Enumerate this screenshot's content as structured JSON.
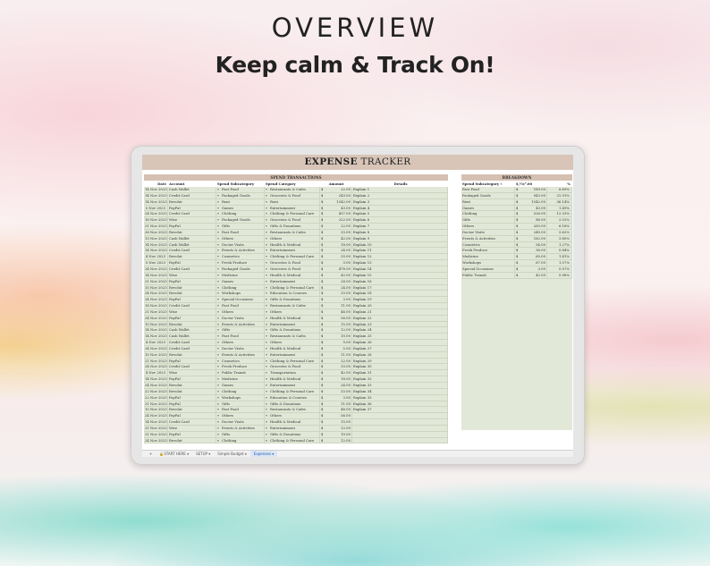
{
  "header": {
    "title": "OVERVIEW",
    "tagline": "Keep calm & Track On!"
  },
  "sheet": {
    "title_bold": "EXPENSE",
    "title_light": " TRACKER",
    "left_heading": "SPEND TRANSACTIONS",
    "right_heading": "BREAKDOWN",
    "columns": {
      "date": "Date",
      "account": "Account",
      "subcategory": "Spend Subcategory",
      "category": "Spend Category",
      "amount": "Amount",
      "details": "Details"
    },
    "breakdown_columns": {
      "subcategory": "Spend Subcategory",
      "amount": "$,½‡⁰.00",
      "percent": "%"
    },
    "currency": "$",
    "transactions": [
      {
        "date": "14 Nov 2023",
        "account": "Cash Wallet",
        "sub": "Fast Food",
        "cat": "Restaurants & Cafes",
        "amt": "22.00",
        "det": "Explain 1"
      },
      {
        "date": "14 Nov 2023",
        "account": "Credit Card",
        "sub": "Packaged Goods",
        "cat": "Groceries & Food",
        "amt": "243.00",
        "det": "Explain 2"
      },
      {
        "date": "14 Nov 2023",
        "account": "Revolut",
        "sub": "Rent",
        "cat": "Rent",
        "amt": "1542.00",
        "det": "Explain 3"
      },
      {
        "date": "5 Nov 2023",
        "account": "PayPal",
        "sub": "Games",
        "cat": "Entertainment",
        "amt": "43.00",
        "det": "Explain 4"
      },
      {
        "date": "24 Nov 2023",
        "account": "Credit Card",
        "sub": "Clothing",
        "cat": "Clothing & Personal Care",
        "amt": "437.00",
        "det": "Explain 5"
      },
      {
        "date": "16 Nov 2023",
        "account": "Wise",
        "sub": "Packaged Goods",
        "cat": "Groceries & Food",
        "amt": "222.00",
        "det": "Explain 6"
      },
      {
        "date": "21 Nov 2023",
        "account": "PayPal",
        "sub": "Gifts",
        "cat": "Gifts & Donations",
        "amt": "22.00",
        "det": "Explain 7"
      },
      {
        "date": "26 Nov 2023",
        "account": "Revolut",
        "sub": "Fast Food",
        "cat": "Restaurants & Cafes",
        "amt": "33.00",
        "det": "Explain 8"
      },
      {
        "date": "13 Nov 2023",
        "account": "Cash Wallet",
        "sub": "Others",
        "cat": "Others",
        "amt": "42.00",
        "det": "Explain 9"
      },
      {
        "date": "14 Nov 2023",
        "account": "Cash Wallet",
        "sub": "Doctor Visits",
        "cat": "Health & Medical",
        "amt": "18.00",
        "det": "Explain 10"
      },
      {
        "date": "14 Nov 2023",
        "account": "Credit Card",
        "sub": "Events & Activities",
        "cat": "Entertainment",
        "amt": "24.00",
        "det": "Explain 11"
      },
      {
        "date": "4 Nov 2023",
        "account": "Revolut",
        "sub": "Cosmetics",
        "cat": "Clothing & Personal Care",
        "amt": "33.00",
        "det": "Explain 12"
      },
      {
        "date": "5 Nov 2023",
        "account": "PayPal",
        "sub": "Fresh Produce",
        "cat": "Groceries & Food",
        "amt": "3.00",
        "det": "Explain 13"
      },
      {
        "date": "24 Nov 2023",
        "account": "Credit Card",
        "sub": "Packaged Goods",
        "cat": "Groceries & Food",
        "amt": "478.00",
        "det": "Explain 14"
      },
      {
        "date": "14 Nov 2023",
        "account": "Wise",
        "sub": "Medicine",
        "cat": "Health & Medical",
        "amt": "42.00",
        "det": "Explain 15"
      },
      {
        "date": "21 Nov 2023",
        "account": "PayPal",
        "sub": "Games",
        "cat": "Entertainment",
        "amt": "28.00",
        "det": "Explain 16"
      },
      {
        "date": "15 Nov 2023",
        "account": "Revolut",
        "sub": "Clothing",
        "cat": "Clothing & Personal Care",
        "amt": "24.00",
        "det": "Explain 17"
      },
      {
        "date": "24 Nov 2023",
        "account": "Revolut",
        "sub": "Workshops",
        "cat": "Education & Courses",
        "amt": "33.00",
        "det": "Explain 18"
      },
      {
        "date": "24 Nov 2023",
        "account": "PayPal",
        "sub": "Special Occasions",
        "cat": "Gifts & Donations",
        "amt": "3.00",
        "det": "Explain 19"
      },
      {
        "date": "16 Nov 2023",
        "account": "Credit Card",
        "sub": "Fast Food",
        "cat": "Restaurants & Cafes",
        "amt": "11.00",
        "det": "Explain 20"
      },
      {
        "date": "21 Nov 2023",
        "account": "Wise",
        "sub": "Others",
        "cat": "Others",
        "amt": "46.00",
        "det": "Explain 21"
      },
      {
        "date": "24 Nov 2023",
        "account": "PayPal",
        "sub": "Doctor Visits",
        "cat": "Health & Medical",
        "amt": "56.00",
        "det": "Explain 22"
      },
      {
        "date": "15 Nov 2023",
        "account": "Revolut",
        "sub": "Events & Activities",
        "cat": "Entertainment",
        "amt": "15.00",
        "det": "Explain 23"
      },
      {
        "date": "14 Nov 2023",
        "account": "Cash Wallet",
        "sub": "Gifts",
        "cat": "Gifts & Donations",
        "amt": "12.00",
        "det": "Explain 24"
      },
      {
        "date": "14 Nov 2023",
        "account": "Cash Wallet",
        "sub": "Fast Food",
        "cat": "Restaurants & Cafes",
        "amt": "10.00",
        "det": "Explain 25"
      },
      {
        "date": "4 Nov 2023",
        "account": "Credit Card",
        "sub": "Others",
        "cat": "Others",
        "amt": "9.00",
        "det": "Explain 26"
      },
      {
        "date": "24 Nov 2023",
        "account": "Credit Card",
        "sub": "Doctor Visits",
        "cat": "Health & Medical",
        "amt": "5.00",
        "det": "Explain 27"
      },
      {
        "date": "15 Nov 2023",
        "account": "Revolut",
        "sub": "Events & Activities",
        "cat": "Entertainment",
        "amt": "11.00",
        "det": "Explain 28"
      },
      {
        "date": "21 Nov 2023",
        "account": "PayPal",
        "sub": "Cosmetics",
        "cat": "Clothing & Personal Care",
        "amt": "22.00",
        "det": "Explain 29"
      },
      {
        "date": "24 Nov 2023",
        "account": "Credit Card",
        "sub": "Fresh Produce",
        "cat": "Groceries & Food",
        "amt": "33.00",
        "det": "Explain 30"
      },
      {
        "date": "4 Nov 2023",
        "account": "Wise",
        "sub": "Public Transit",
        "cat": "Transportation",
        "amt": "42.00",
        "det": "Explain 31"
      },
      {
        "date": "14 Nov 2023",
        "account": "PayPal",
        "sub": "Medicine",
        "cat": "Health & Medical",
        "amt": "18.00",
        "det": "Explain 32"
      },
      {
        "date": "24 Nov 2023",
        "account": "Revolut",
        "sub": "Games",
        "cat": "Entertainment",
        "amt": "24.00",
        "det": "Explain 33"
      },
      {
        "date": "22 Nov 2023",
        "account": "Revolut",
        "sub": "Clothing",
        "cat": "Clothing & Personal Care",
        "amt": "33.00",
        "det": "Explain 34"
      },
      {
        "date": "22 Nov 2023",
        "account": "PayPal",
        "sub": "Workshops",
        "cat": "Education & Courses",
        "amt": "3.00",
        "det": "Explain 35"
      },
      {
        "date": "21 Nov 2023",
        "account": "PayPal",
        "sub": "Gifts",
        "cat": "Gifts & Donations",
        "amt": "11.00",
        "det": "Explain 36"
      },
      {
        "date": "15 Nov 2023",
        "account": "Revolut",
        "sub": "Fast Food",
        "cat": "Restaurants & Cafes",
        "amt": "46.00",
        "det": "Explain 37"
      },
      {
        "date": "24 Nov 2023",
        "account": "PayPal",
        "sub": "Others",
        "cat": "Others",
        "amt": "56.00",
        "det": ""
      },
      {
        "date": "14 Nov 2023",
        "account": "Credit Card",
        "sub": "Doctor Visits",
        "cat": "Health & Medical",
        "amt": "15.00",
        "det": ""
      },
      {
        "date": "21 Nov 2023",
        "account": "Wise",
        "sub": "Events & Activities",
        "cat": "Entertainment",
        "amt": "12.00",
        "det": ""
      },
      {
        "date": "21 Nov 2023",
        "account": "PayPal",
        "sub": "Gifts",
        "cat": "Gifts & Donations",
        "amt": "10.00",
        "det": ""
      },
      {
        "date": "24 Nov 2023",
        "account": "Revolut",
        "sub": "Clothing",
        "cat": "Clothing & Personal Care",
        "amt": "12.00",
        "det": ""
      }
    ],
    "breakdown": [
      {
        "sub": "Fast Food",
        "amt": "189.00",
        "pct": "6.69%"
      },
      {
        "sub": "Packaged Goods",
        "amt": "943.00",
        "pct": "21.91%"
      },
      {
        "sub": "Rent",
        "amt": "1542.00",
        "pct": "36.14%"
      },
      {
        "sub": "Games",
        "amt": "43.00",
        "pct": "1.49%"
      },
      {
        "sub": "Clothing",
        "amt": "526.00",
        "pct": "12.33%"
      },
      {
        "sub": "Gifts",
        "amt": "86.00",
        "pct": "2.02%"
      },
      {
        "sub": "Others",
        "amt": "263.00",
        "pct": "6.16%"
      },
      {
        "sub": "Doctor Visits",
        "amt": "240.00",
        "pct": "5.62%"
      },
      {
        "sub": "Events & Activities",
        "amt": "162.00",
        "pct": "3.80%"
      },
      {
        "sub": "Cosmetics",
        "amt": "54.00",
        "pct": "1.27%"
      },
      {
        "sub": "Fresh Produce",
        "amt": "36.00",
        "pct": "0.84%"
      },
      {
        "sub": "Medicine",
        "amt": "60.00",
        "pct": "1.41%"
      },
      {
        "sub": "Workshops",
        "amt": "67.00",
        "pct": "1.57%"
      },
      {
        "sub": "Special Occasions",
        "amt": "3.00",
        "pct": "0.07%"
      },
      {
        "sub": "Public Transit",
        "amt": "42.00",
        "pct": "0.98%"
      }
    ]
  },
  "tabs": {
    "add": "+",
    "items": [
      {
        "label": "START HERE",
        "icon": "lock-icon"
      },
      {
        "label": "SETUP"
      },
      {
        "label": "Simple Budget"
      },
      {
        "label": "Expenses",
        "active": true
      }
    ],
    "dropdown_glyph": "▾"
  }
}
